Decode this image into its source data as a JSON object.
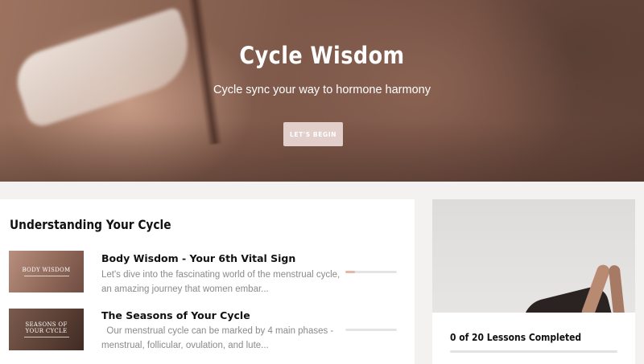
{
  "hero": {
    "title": "Cycle Wisdom",
    "subtitle": "Cycle sync your way to hormone harmony",
    "cta_label": "LET'S BEGIN"
  },
  "course": {
    "section_title": "Understanding Your Cycle",
    "lessons": [
      {
        "thumb_text": "BODY WISDOM",
        "title": "Body Wisdom - Your 6th Vital Sign",
        "description": "Let's dive into the fascinating world of the menstrual cycle, an amazing journey that women embar...",
        "progress_fraction": 0.18
      },
      {
        "thumb_text": "SEASONS OF YOUR CYCLE",
        "title": "The Seasons of Your Cycle",
        "description": "  Our menstrual cycle can be marked by 4 main phases - menstrual, follicular, ovulation, and lute...",
        "progress_fraction": 0
      }
    ]
  },
  "sidebar": {
    "progress_text": "0 of 20 Lessons Completed",
    "progress_fraction": 0
  },
  "colors": {
    "button_bg": "#e2cfcb",
    "progress_accent": "#e8b6a5",
    "track": "#e4e4e4"
  }
}
